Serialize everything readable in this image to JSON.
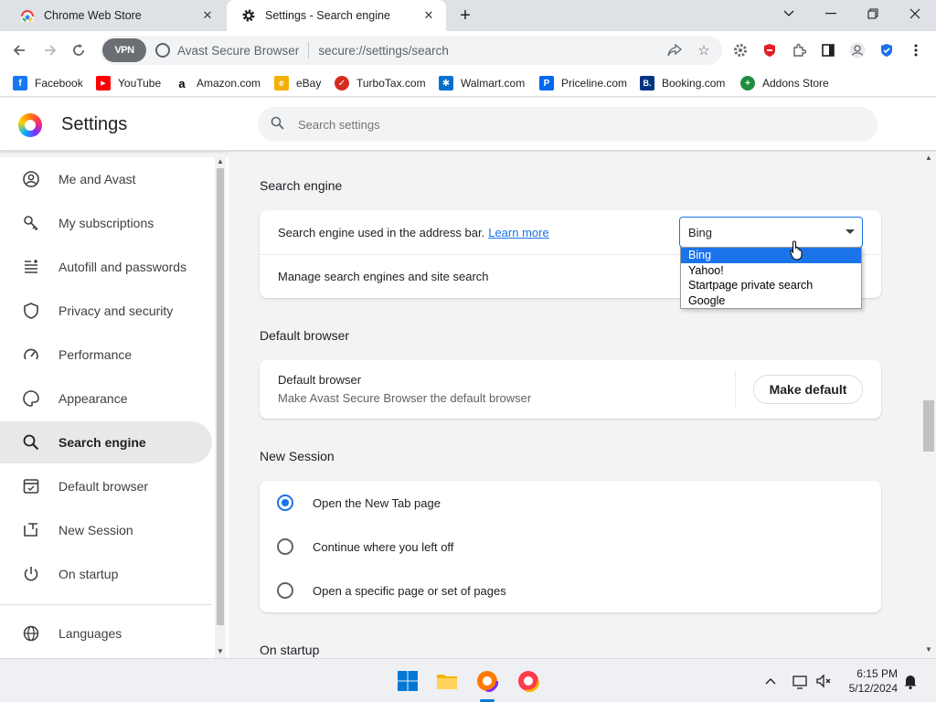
{
  "tabs": [
    {
      "title": "Chrome Web Store",
      "icon": "chrome-web-store-icon"
    },
    {
      "title": "Settings - Search engine",
      "icon": "gear-icon"
    }
  ],
  "toolbar": {
    "vpn_label": "VPN",
    "site_name": "Avast Secure Browser",
    "url": "secure://settings/search"
  },
  "bookmarks": [
    {
      "label": "Facebook",
      "color": "#1877f2",
      "glyph": "f"
    },
    {
      "label": "YouTube",
      "color": "#ff0000",
      "glyph": "▶"
    },
    {
      "label": "Amazon.com",
      "color": "#000000",
      "glyph": "a"
    },
    {
      "label": "eBay",
      "color": "#e53238",
      "glyph": "e"
    },
    {
      "label": "TurboTax.com",
      "color": "#d52b1e",
      "glyph": "✓"
    },
    {
      "label": "Walmart.com",
      "color": "#0071ce",
      "glyph": "✱"
    },
    {
      "label": "Priceline.com",
      "color": "#0068ef",
      "glyph": "P"
    },
    {
      "label": "Booking.com",
      "color": "#003580",
      "glyph": "B."
    },
    {
      "label": "Addons Store",
      "color": "#1e8e3e",
      "glyph": "+"
    }
  ],
  "header": {
    "title": "Settings",
    "search_placeholder": "Search settings"
  },
  "sidebar": {
    "items": [
      {
        "label": "Me and Avast",
        "icon": "account-icon"
      },
      {
        "label": "My subscriptions",
        "icon": "key-icon"
      },
      {
        "label": "Autofill and passwords",
        "icon": "autofill-icon"
      },
      {
        "label": "Privacy and security",
        "icon": "shield-icon"
      },
      {
        "label": "Performance",
        "icon": "speedometer-icon"
      },
      {
        "label": "Appearance",
        "icon": "palette-icon"
      },
      {
        "label": "Search engine",
        "icon": "search-icon",
        "active": true
      },
      {
        "label": "Default browser",
        "icon": "browser-icon"
      },
      {
        "label": "New Session",
        "icon": "new-session-icon"
      },
      {
        "label": "On startup",
        "icon": "power-icon"
      },
      {
        "label": "Languages",
        "icon": "globe-icon"
      }
    ]
  },
  "search_engine": {
    "section_title": "Search engine",
    "address_bar_text": "Search engine used in the address bar.",
    "learn_more": "Learn more",
    "manage_text": "Manage search engines and site search",
    "selected": "Bing",
    "options": [
      "Bing",
      "Yahoo!",
      "Startpage private search",
      "Google"
    ]
  },
  "default_browser": {
    "section_title": "Default browser",
    "title": "Default browser",
    "description": "Make Avast Secure Browser the default browser",
    "button": "Make default"
  },
  "new_session": {
    "section_title": "New Session",
    "options": [
      {
        "label": "Open the New Tab page",
        "checked": true
      },
      {
        "label": "Continue where you left off",
        "checked": false
      },
      {
        "label": "Open a specific page or set of pages",
        "checked": false
      }
    ]
  },
  "on_startup": {
    "section_title": "On startup"
  },
  "taskbar": {
    "time": "6:15 PM",
    "date": "5/12/2024"
  },
  "colors": {
    "accent": "#1a73e8",
    "active_sidebar": "#e8e8e8"
  }
}
